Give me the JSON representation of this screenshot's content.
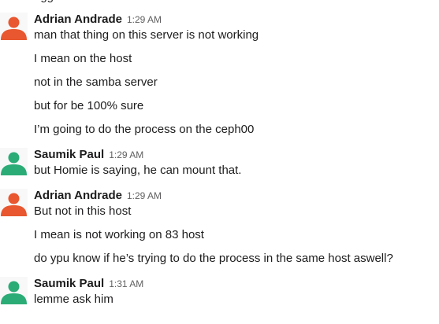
{
  "clipped_top_text": "ugg",
  "colors": {
    "adrian_avatar": "#e8572f",
    "saumik_avatar": "#2bac76",
    "avatar_bg": "#f8f8f8"
  },
  "groups": [
    {
      "author": "Adrian Andrade",
      "time": "1:29 AM",
      "avatar_icon": "person-icon",
      "messages": [
        "man that thing on this server is not working",
        "I mean on the host",
        "not in the samba server",
        "but for be 100% sure",
        "I’m going to do the process on the ceph00"
      ]
    },
    {
      "author": "Saumik Paul",
      "time": "1:29 AM",
      "avatar_icon": "person-icon",
      "messages": [
        "but Homie is saying, he can mount that."
      ]
    },
    {
      "author": "Adrian Andrade",
      "time": "1:29 AM",
      "avatar_icon": "person-icon",
      "messages": [
        "But not in this host",
        "I mean is not working on 83 host",
        "do ypu know if he’s trying to do the process in the same host aswell?"
      ]
    },
    {
      "author": "Saumik Paul",
      "time": "1:31 AM",
      "avatar_icon": "person-icon",
      "messages": [
        "lemme ask him"
      ]
    }
  ]
}
